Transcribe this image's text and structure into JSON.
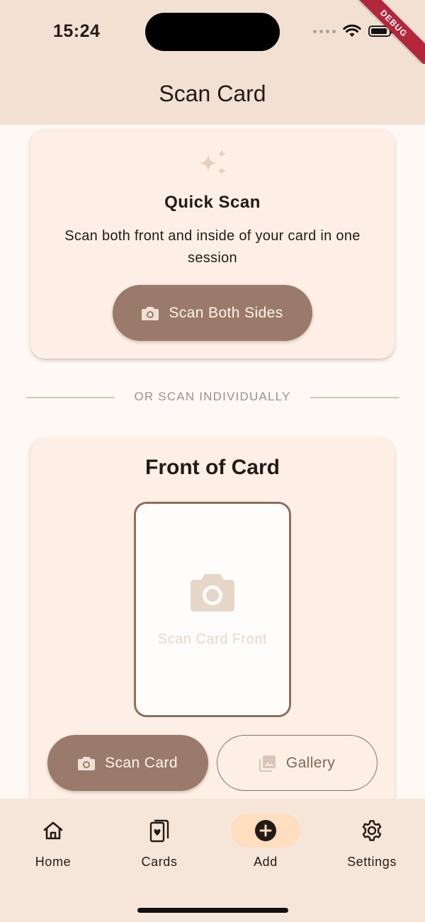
{
  "status_bar": {
    "time": "15:24",
    "debug_banner": "DEBUG"
  },
  "app_bar": {
    "title": "Scan Card"
  },
  "quick_scan": {
    "icon": "sparkle-icon",
    "title": "Quick Scan",
    "description": "Scan both front and inside of your card in one session",
    "button_label": "Scan Both Sides",
    "button_icon": "camera-icon"
  },
  "divider": {
    "label": "OR SCAN INDIVIDUALLY"
  },
  "front": {
    "title": "Front of Card",
    "placeholder_label": "Scan Card Front",
    "placeholder_icon": "camera-icon",
    "scan_button_label": "Scan Card",
    "gallery_button_label": "Gallery"
  },
  "bottom_nav": {
    "items": [
      {
        "label": "Home",
        "icon": "home-icon",
        "active": false
      },
      {
        "label": "Cards",
        "icon": "cards-icon",
        "active": false
      },
      {
        "label": "Add",
        "icon": "add-circle-icon",
        "active": true
      },
      {
        "label": "Settings",
        "icon": "gear-icon",
        "active": false
      }
    ]
  },
  "colors": {
    "background": "#FFF8F4",
    "app_bar": "#F2E0D3",
    "card": "#FDEFE5",
    "primary_button": "#9A7A6A",
    "active_nav": "#FFDDBF",
    "debug_ribbon": "#B3263C"
  }
}
